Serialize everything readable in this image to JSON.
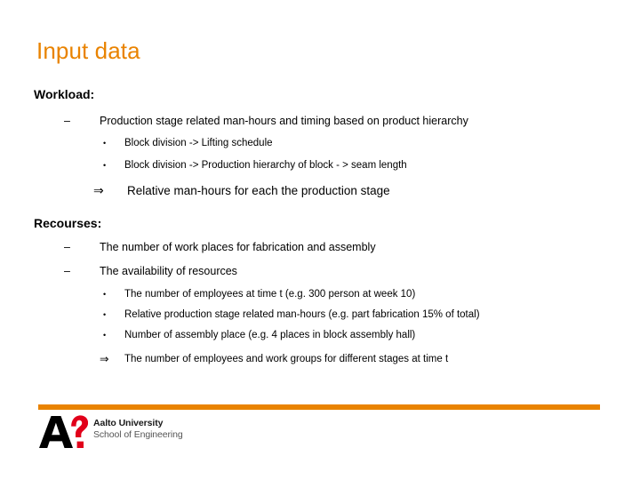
{
  "slide": {
    "title": "Input data",
    "accent_color": "#E98300",
    "background_color": "#FFFFFF",
    "sections": [
      {
        "heading": "Workload:",
        "items": [
          {
            "level": 2,
            "marker": "–",
            "text": "Production stage related man-hours and timing based on product hierarchy"
          },
          {
            "level": 3,
            "marker": "•",
            "text": "Block division -> Lifting schedule"
          },
          {
            "level": 3,
            "marker": "•",
            "text": "Block division -> Production hierarchy of block - > seam length"
          },
          {
            "level": "arrow-big",
            "marker": "⇒",
            "text": "Relative man-hours for each the production stage"
          }
        ]
      },
      {
        "heading": "Recourses:",
        "items": [
          {
            "level": 2,
            "marker": "–",
            "text": "The number of work places for fabrication and assembly"
          },
          {
            "level": 2,
            "marker": "–",
            "text": "The availability of resources"
          },
          {
            "level": 3,
            "marker": "•",
            "text": "The number of employees at time t (e.g. 300 person at week 10)"
          },
          {
            "level": 3,
            "marker": "•",
            "text": "Relative production stage related man-hours (e.g. part fabrication 15% of total)"
          },
          {
            "level": 3,
            "marker": "•",
            "text": "Number of assembly place (e.g. 4 places in block assembly hall)"
          },
          {
            "level": "arrow-small",
            "marker": "⇒",
            "text": "The number of employees and work groups for different stages at time t"
          }
        ]
      }
    ]
  },
  "footer": {
    "rule_color": "#E98300",
    "logo": {
      "letter": "A",
      "letter_color": "#000000",
      "symbol": "?",
      "symbol_color": "#E1001A",
      "organization": "Aalto University",
      "unit": "School of Engineering"
    }
  }
}
